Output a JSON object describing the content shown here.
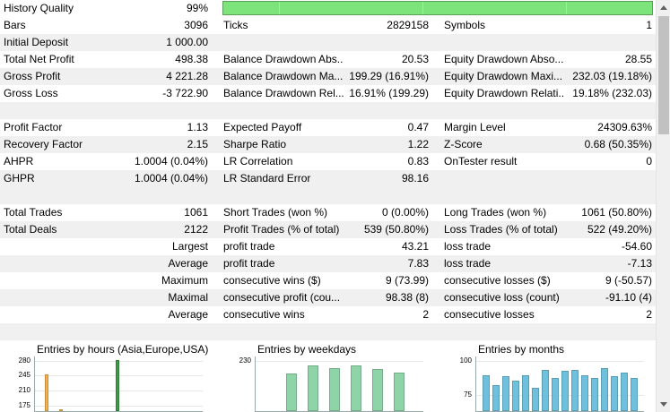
{
  "history_quality": {
    "label": "History Quality",
    "value": "99%"
  },
  "rows_top": [
    {
      "l1": "Bars",
      "v1": "3096",
      "l2": "Ticks",
      "v2": "2829158",
      "l3": "Symbols",
      "v3": "1"
    },
    {
      "l1": "Initial Deposit",
      "v1": "1 000.00",
      "l2": "",
      "v2": "",
      "l3": "",
      "v3": ""
    },
    {
      "l1": "Total Net Profit",
      "v1": "498.38",
      "l2": "Balance Drawdown Abs...",
      "v2": "20.53",
      "l3": "Equity Drawdown Abso...",
      "v3": "28.55"
    },
    {
      "l1": "Gross Profit",
      "v1": "4 221.28",
      "l2": "Balance Drawdown Ma...",
      "v2": "199.29 (16.91%)",
      "l3": "Equity Drawdown Maxi...",
      "v3": "232.03 (19.18%)"
    },
    {
      "l1": "Gross Loss",
      "v1": "-3 722.90",
      "l2": "Balance Drawdown Rel...",
      "v2": "16.91% (199.29)",
      "l3": "Equity Drawdown Relati...",
      "v3": "19.18% (232.03)"
    }
  ],
  "rows_mid": [
    {
      "l1": "Profit Factor",
      "v1": "1.13",
      "l2": "Expected Payoff",
      "v2": "0.47",
      "l3": "Margin Level",
      "v3": "24309.63%"
    },
    {
      "l1": "Recovery Factor",
      "v1": "2.15",
      "l2": "Sharpe Ratio",
      "v2": "1.22",
      "l3": "Z-Score",
      "v3": "0.68 (50.35%)"
    },
    {
      "l1": "AHPR",
      "v1": "1.0004 (0.04%)",
      "l2": "LR Correlation",
      "v2": "0.83",
      "l3": "OnTester result",
      "v3": "0"
    },
    {
      "l1": "GHPR",
      "v1": "1.0004 (0.04%)",
      "l2": "LR Standard Error",
      "v2": "98.16",
      "l3": "",
      "v3": ""
    }
  ],
  "rows_trades": [
    {
      "l1": "Total Trades",
      "v1": "1061",
      "l2": "Short Trades (won %)",
      "v2": "0 (0.00%)",
      "l3": "Long Trades (won %)",
      "v3": "1061 (50.80%)",
      "right": false
    },
    {
      "l1": "Total Deals",
      "v1": "2122",
      "l2": "Profit Trades (% of total)",
      "v2": "539 (50.80%)",
      "l3": "Loss Trades (% of total)",
      "v3": "522 (49.20%)",
      "right": false
    },
    {
      "l1": "Largest",
      "v1": "",
      "l2": "profit trade",
      "v2": "43.21",
      "l3": "loss trade",
      "v3": "-54.60",
      "right": true
    },
    {
      "l1": "Average",
      "v1": "",
      "l2": "profit trade",
      "v2": "7.83",
      "l3": "loss trade",
      "v3": "-7.13",
      "right": true
    },
    {
      "l1": "Maximum",
      "v1": "",
      "l2": "consecutive wins ($)",
      "v2": "9 (73.99)",
      "l3": "consecutive losses ($)",
      "v3": "9 (-50.57)",
      "right": true
    },
    {
      "l1": "Maximal",
      "v1": "",
      "l2": "consecutive profit (cou...",
      "v2": "98.38 (8)",
      "l3": "consecutive loss (count)",
      "v3": "-91.10 (4)",
      "right": true
    },
    {
      "l1": "Average",
      "v1": "",
      "l2": "consecutive wins",
      "v2": "2",
      "l3": "consecutive losses",
      "v3": "2",
      "right": true
    }
  ],
  "charts": {
    "hours": {
      "title": "Entries by hours (Asia,Europe,USA)",
      "yticks": [
        "280",
        "245",
        "210",
        "175"
      ],
      "ymin": 160,
      "ymax": 290,
      "bars": [
        {
          "i": 0,
          "v": 245,
          "color": "#f5b04a"
        },
        {
          "i": 2,
          "v": 163,
          "color": "#f5b04a"
        },
        {
          "i": 10,
          "v": 280,
          "color": "#3d9a48"
        }
      ]
    },
    "weekdays": {
      "title": "Entries by weekdays",
      "yticks": [
        "230"
      ],
      "ymin": 170,
      "ymax": 235,
      "values": [
        214,
        224,
        220,
        223,
        219,
        215
      ]
    },
    "months": {
      "title": "Entries by months",
      "yticks": [
        "100",
        "75"
      ],
      "ymin": 63,
      "ymax": 103,
      "values": [
        89,
        82,
        88,
        85,
        89,
        80,
        93,
        87,
        92,
        93,
        89,
        87,
        94,
        88,
        91,
        87
      ]
    }
  },
  "colors": {
    "shade": "#f0f0f0",
    "quality_bar": "#7de37b",
    "weekday_bar": "#8fd3a8",
    "month_bar": "#6ec0dd"
  }
}
